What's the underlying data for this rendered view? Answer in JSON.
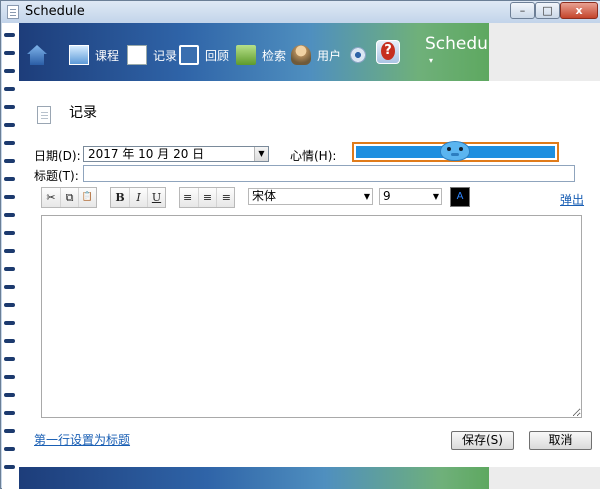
{
  "window": {
    "title": "Schedule",
    "controls": {
      "minimize": "–",
      "maximize": "□",
      "close": "x"
    }
  },
  "toolbar": {
    "items": [
      {
        "icon": "home-icon",
        "label": ""
      },
      {
        "icon": "course-icon",
        "label": "课程"
      },
      {
        "icon": "record-icon",
        "label": "记录"
      },
      {
        "icon": "review-icon",
        "label": "回顾"
      },
      {
        "icon": "search-icon",
        "label": "检索"
      },
      {
        "icon": "user-icon",
        "label": "用户"
      },
      {
        "icon": "gear-icon",
        "label": ""
      },
      {
        "icon": "help-icon",
        "label": ""
      }
    ],
    "brand": "Schedule",
    "brand_arrow": "▾"
  },
  "page": {
    "title": "记录"
  },
  "form": {
    "date_label": "日期(D):",
    "date_value": "2017 年 10 月 20 日",
    "mood_label": "心情(H):",
    "title_label": "标题(T):",
    "title_value": ""
  },
  "format": {
    "cut": "✂",
    "copy": "⧉",
    "paste": "📋",
    "bold": "B",
    "italic": "I",
    "underline": "U",
    "align_left": "≡",
    "align_center": "≡",
    "align_right": "≡",
    "font": "宋体",
    "size": "9",
    "color_glyph": "A",
    "color_value": "#000000",
    "popout": "弹出"
  },
  "footer": {
    "first_line_link": "第一行设置为标题",
    "save": "保存(S)",
    "cancel": "取消"
  },
  "colors": {
    "accent_border": "#e07b1a",
    "mood_fill": "#1e8fe0",
    "link": "#1a5fb4"
  }
}
